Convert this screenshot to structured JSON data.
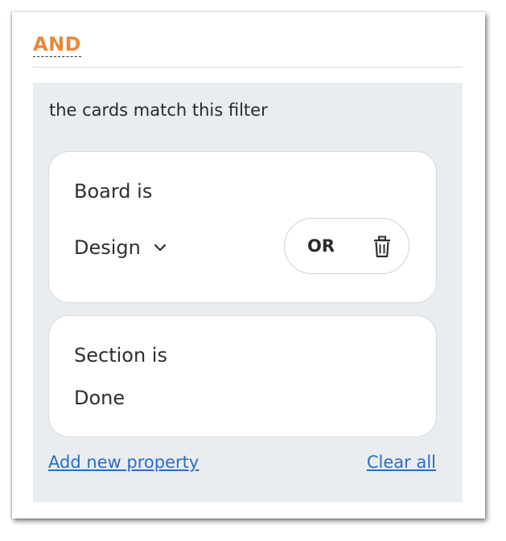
{
  "header": {
    "operator_label": "AND"
  },
  "panel": {
    "title": "the cards match this filter",
    "filters": [
      {
        "property_label": "Board is",
        "value": "Design",
        "has_dropdown": true,
        "or_label": "OR",
        "trash_icon": "trash-icon"
      },
      {
        "property_label": "Section is",
        "value": "Done"
      }
    ],
    "add_property_label": "Add new property",
    "clear_all_label": "Clear all"
  },
  "colors": {
    "accent": "#e8893a",
    "link": "#2b6cc4",
    "panel_bg": "#e9edf0"
  }
}
